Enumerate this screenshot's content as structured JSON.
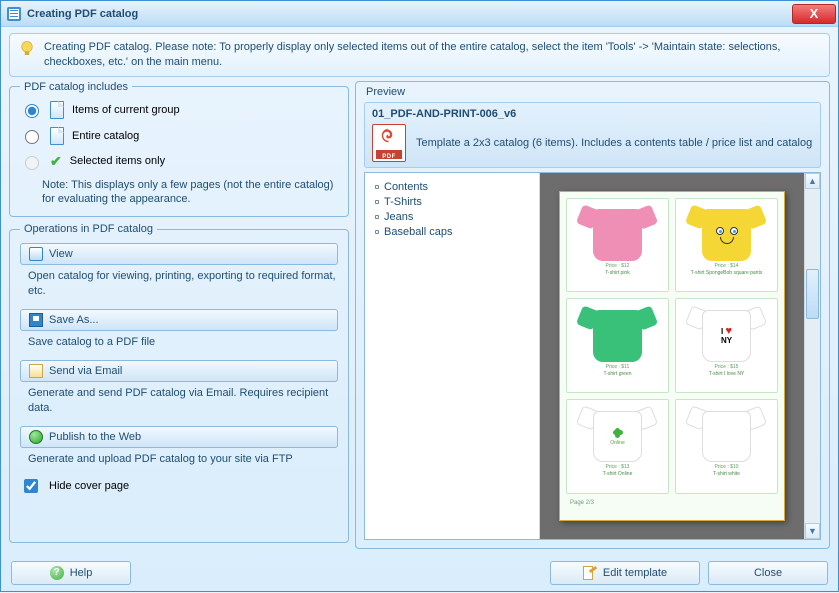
{
  "window": {
    "title": "Creating PDF catalog"
  },
  "info": {
    "text": "Creating PDF catalog. Please note: To properly display only selected items out of the entire catalog, select the item  'Tools' -> 'Maintain state: selections, checkboxes, etc.' on the main menu."
  },
  "includes": {
    "legend": "PDF catalog includes",
    "opt1": "Items of current group",
    "opt2": "Entire catalog",
    "opt3": "Selected items only",
    "note": "Note: This displays only a few pages (not the entire catalog) for evaluating the appearance."
  },
  "operations": {
    "legend": "Operations in PDF catalog",
    "view_label": "View",
    "view_desc": "Open catalog for viewing, printing, exporting to required format, etc.",
    "save_label": "Save As...",
    "save_desc": "Save catalog to a PDF file",
    "email_label": "Send via Email",
    "email_desc": "Generate and send PDF catalog via Email. Requires recipient data.",
    "publish_label": "Publish to the Web",
    "publish_desc": "Generate and upload PDF catalog to your site via FTP",
    "hide_cover": "Hide cover page"
  },
  "preview": {
    "legend": "Preview",
    "template_name": "01_PDF-AND-PRINT-006_v6",
    "template_desc": "Template a 2x3 catalog (6 items). Includes a contents table / price list and catalog",
    "toc": [
      "Contents",
      "T-Shirts",
      "Jeans",
      "Baseball caps"
    ]
  },
  "catalog": {
    "items": [
      {
        "color": "#f08fb6",
        "price": "Price : $12",
        "name": "T-shirt pink"
      },
      {
        "color": "#f4d735",
        "price": "Price : $14",
        "name": "T-shirt SpongeBob square pants"
      },
      {
        "color": "#39c17a",
        "price": "Price : $11",
        "name": "T-shirt green"
      },
      {
        "color": "#ffffff",
        "price": "Price : $15",
        "name": "T-shirt I love NY"
      },
      {
        "color": "#ffffff",
        "price": "Price : $13",
        "name": "T-shirt Online"
      },
      {
        "color": "#ffffff",
        "price": "Price : $10",
        "name": "T-shirt white"
      }
    ],
    "page_label": "Page 2/3"
  },
  "buttons": {
    "help": "Help",
    "edit": "Edit template",
    "close": "Close"
  }
}
